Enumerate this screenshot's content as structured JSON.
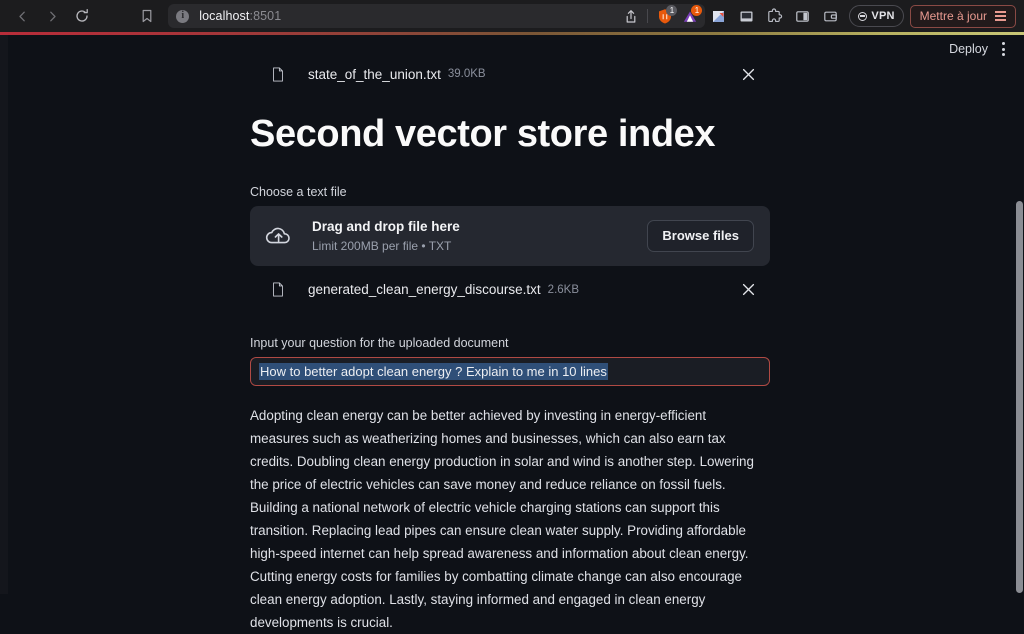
{
  "browser": {
    "back_icon": "chevron-left-icon",
    "forward_icon": "chevron-right-icon",
    "reload_icon": "reload-icon",
    "bookmark_icon": "bookmark-icon",
    "url_host": "localhost",
    "url_port": ":8501",
    "site_info_icon": "info-icon",
    "share_icon": "share-icon",
    "extension_1_icon": "shield-extension-icon",
    "extension_1_badge": "1",
    "extension_2_icon": "triangle-extension-icon",
    "extension_2_badge": "1",
    "toolbar_icons": [
      "app-icon",
      "screen-icon",
      "puzzle-extensions-icon",
      "sidebar-toggle-icon",
      "wallet-icon"
    ],
    "vpn_label": "VPN",
    "vpn_icon": "vpn-icon",
    "update_label": "Mettre à jour",
    "update_menu_icon": "hamburger-icon",
    "accent_update": "#e89a90",
    "loadbar_start_color": "#b82d3a",
    "loadbar_end_color": "#c9c777"
  },
  "app": {
    "deploy_label": "Deploy",
    "menu_icon": "kebab-menu-icon",
    "title": "Second vector store index",
    "background": "#0e1117",
    "uploaded_file_top": {
      "icon": "file-icon",
      "name": "state_of_the_union.txt",
      "size": "39.0KB",
      "close_icon": "close-icon"
    },
    "uploader": {
      "label": "Choose a text file",
      "cloud_icon": "cloud-upload-icon",
      "drag_text": "Drag and drop file here",
      "limit_text": "Limit 200MB per file • TXT",
      "browse_label": "Browse files"
    },
    "uploaded_file_bottom": {
      "icon": "file-icon",
      "name": "generated_clean_energy_discourse.txt",
      "size": "2.6KB",
      "close_icon": "close-icon"
    },
    "question": {
      "label": "Input your question for the uploaded document",
      "value": "How to better adopt clean energy ? Explain to me in 10 lines",
      "border_color": "#b04a44",
      "selection_color": "#2f4f78"
    },
    "answer": "Adopting clean energy can be better achieved by investing in energy-efficient measures such as weatherizing homes and businesses, which can also earn tax credits. Doubling clean energy production in solar and wind is another step. Lowering the price of electric vehicles can save money and reduce reliance on fossil fuels. Building a national network of electric vehicle charging stations can support this transition. Replacing lead pipes can ensure clean water supply. Providing affordable high-speed internet can help spread awareness and information about clean energy. Cutting energy costs for families by combatting climate change can also encourage clean energy adoption. Lastly, staying informed and engaged in clean energy developments is crucial."
  }
}
